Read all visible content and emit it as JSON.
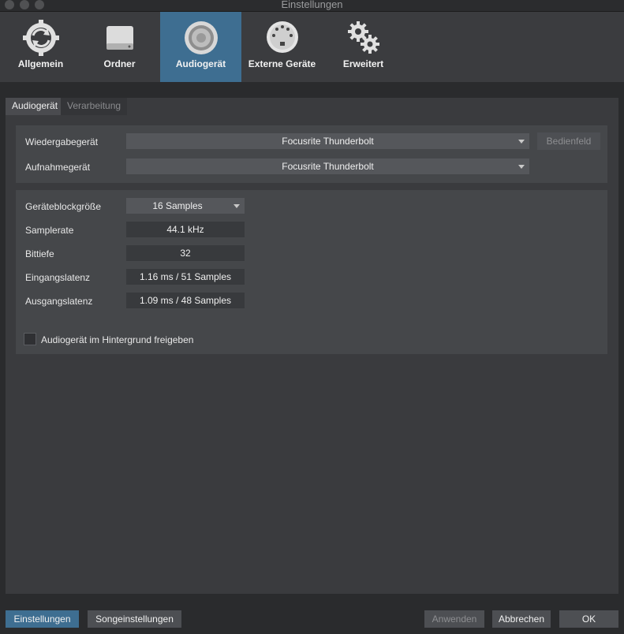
{
  "window": {
    "title": "Einstellungen"
  },
  "toolbar": {
    "items": [
      {
        "label": "Allgemein",
        "icon": "sync-icon",
        "active": false
      },
      {
        "label": "Ordner",
        "icon": "drive-icon",
        "active": false
      },
      {
        "label": "Audiogerät",
        "icon": "speaker-icon",
        "active": true
      },
      {
        "label": "Externe Geräte",
        "icon": "midi-port-icon",
        "active": false
      },
      {
        "label": "Erweitert",
        "icon": "gears-icon",
        "active": false
      }
    ]
  },
  "tabs": {
    "audio": "Audiogerät",
    "processing": "Verarbeitung"
  },
  "devices": {
    "playback_label": "Wiedergabegerät",
    "playback_value": "Focusrite Thunderbolt",
    "control_panel_button": "Bedienfeld",
    "record_label": "Aufnahmegerät",
    "record_value": "Focusrite Thunderbolt"
  },
  "settings": {
    "block_size_label": "Geräteblockgröße",
    "block_size_value": "16 Samples",
    "sample_rate_label": "Samplerate",
    "sample_rate_value": "44.1 kHz",
    "bit_depth_label": "Bittiefe",
    "bit_depth_value": "32",
    "input_latency_label": "Eingangslatenz",
    "input_latency_value": "1.16 ms / 51 Samples",
    "output_latency_label": "Ausgangslatenz",
    "output_latency_value": "1.09 ms / 48 Samples",
    "release_background_label": "Audiogerät im Hintergrund freigeben",
    "release_background_checked": false
  },
  "footer": {
    "preferences": "Einstellungen",
    "song_settings": "Songeinstellungen",
    "apply": "Anwenden",
    "cancel": "Abbrechen",
    "ok": "OK"
  },
  "colors": {
    "accent": "#3e6e91",
    "background": "#2a2b2d",
    "panel": "#45474a"
  }
}
